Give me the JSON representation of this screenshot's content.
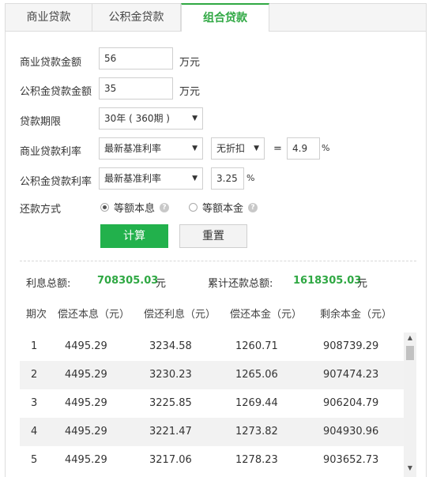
{
  "tabs": [
    {
      "label": "商业贷款"
    },
    {
      "label": "公积金贷款"
    },
    {
      "label": "组合贷款"
    }
  ],
  "form": {
    "commercial_amount": {
      "label": "商业贷款金额",
      "value": "56",
      "unit": "万元"
    },
    "fund_amount": {
      "label": "公积金贷款金额",
      "value": "35",
      "unit": "万元"
    },
    "term": {
      "label": "贷款期限",
      "value": "30年 ( 360期 )"
    },
    "commercial_rate": {
      "label": "商业贷款利率",
      "base": "最新基准利率",
      "discount": "无折扣",
      "equals": "=",
      "value": "4.9",
      "unit": "%"
    },
    "fund_rate": {
      "label": "公积金贷款利率",
      "base": "最新基准利率",
      "value": "3.25",
      "unit": "%"
    },
    "repay": {
      "label": "还款方式",
      "option1": "等额本息",
      "option2": "等额本金",
      "selected": "等额本息"
    }
  },
  "buttons": {
    "calc": "计算",
    "reset": "重置"
  },
  "summary": {
    "interest_label": "利息总额:",
    "interest_value": "708305.03",
    "interest_unit": "元",
    "total_label": "累计还款总额:",
    "total_value": "1618305.03",
    "total_unit": "元"
  },
  "table": {
    "headers": [
      "期次",
      "偿还本息（元）",
      "偿还利息（元）",
      "偿还本金（元）",
      "剩余本金（元）"
    ],
    "rows": [
      [
        "1",
        "4495.29",
        "3234.58",
        "1260.71",
        "908739.29"
      ],
      [
        "2",
        "4495.29",
        "3230.23",
        "1265.06",
        "907474.23"
      ],
      [
        "3",
        "4495.29",
        "3225.85",
        "1269.44",
        "906204.79"
      ],
      [
        "4",
        "4495.29",
        "3221.47",
        "1273.82",
        "904930.96"
      ],
      [
        "5",
        "4495.29",
        "3217.06",
        "1278.23",
        "903652.73"
      ]
    ]
  },
  "icons": {
    "help": "help-icon",
    "arrow": "chevron-down-icon"
  },
  "colors": {
    "accent": "#2fa843",
    "button": "#22b14c"
  }
}
